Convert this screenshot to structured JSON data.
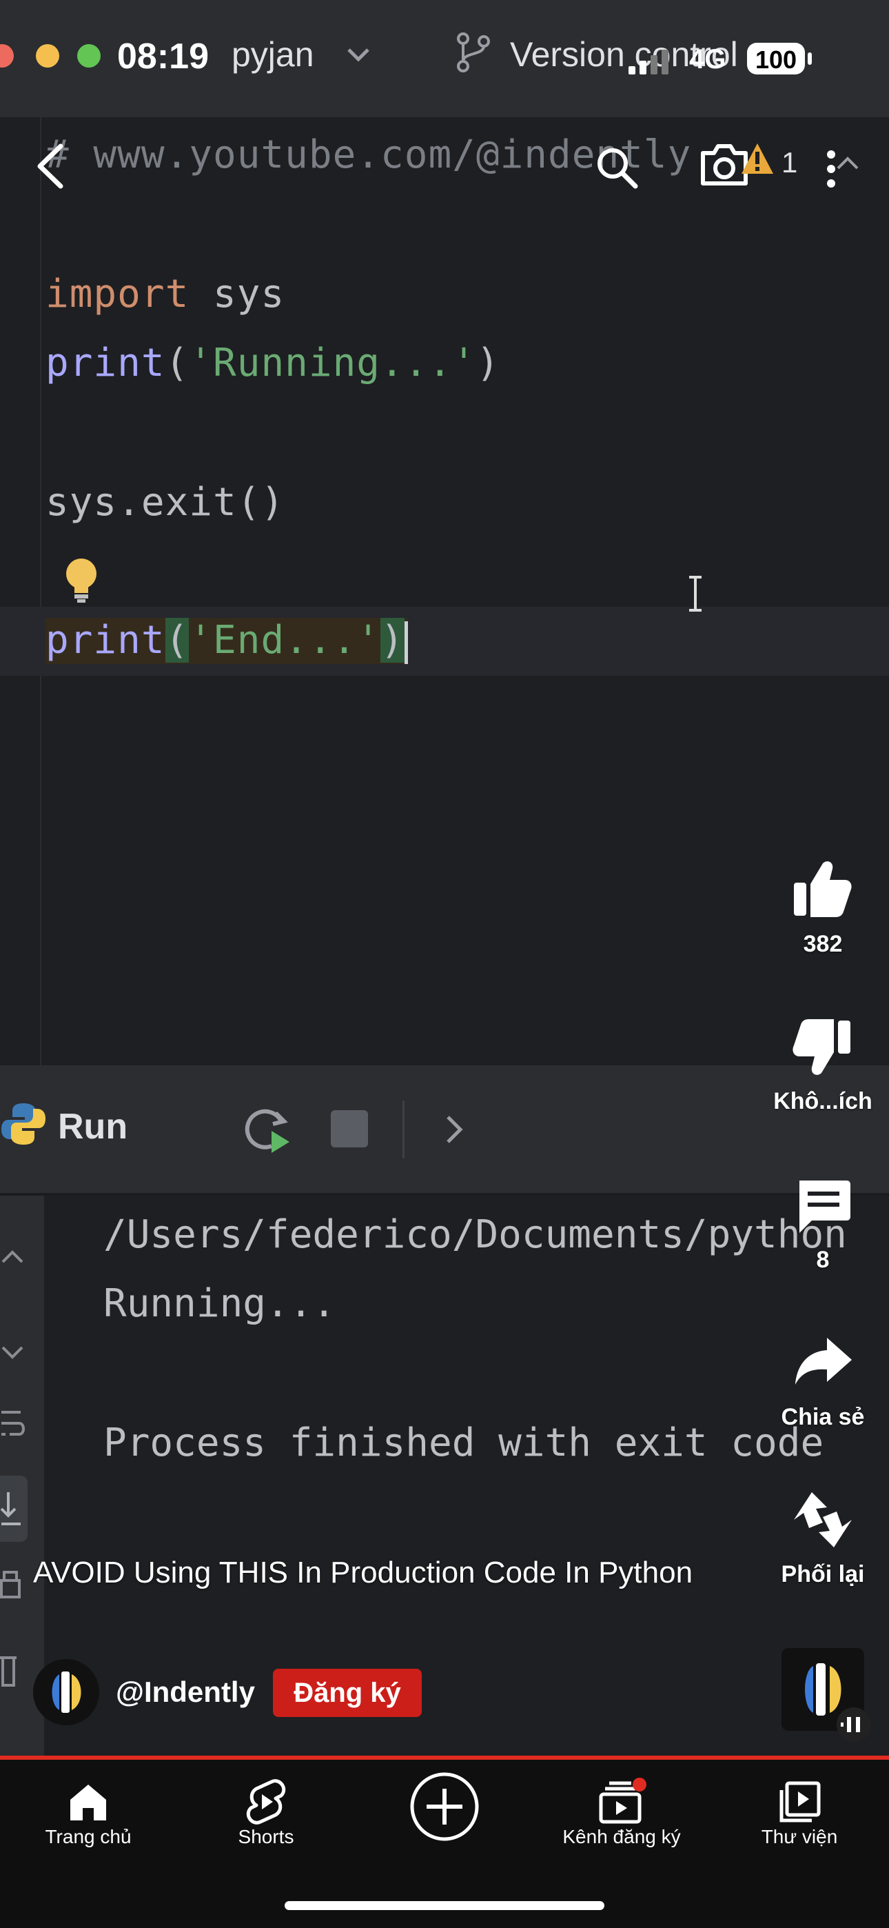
{
  "status_bar": {
    "time": "08:19",
    "network": "4G",
    "battery": "100"
  },
  "ide": {
    "project_name": "pyjan",
    "vcs_label": "Version control",
    "comment_line": "# www.youtube.com/@indently",
    "warning_count": "1",
    "code": {
      "line1_kw": "import",
      "line1_rest": " sys",
      "line2_fn": "print",
      "line2_open": "(",
      "line2_str": "'Running...'",
      "line2_close": ")",
      "line3": "sys.exit()",
      "line4_fn": "print",
      "line4_open": "(",
      "line4_str": "'End...'",
      "line4_close": ")"
    },
    "run_tab_label": "Run",
    "console": {
      "line1": "/Users/federico/Documents/python",
      "line2": "Running...",
      "line3": "Process finished with exit code"
    }
  },
  "video": {
    "title": "AVOID Using THIS In Production Code In Python",
    "channel": "@Indently",
    "subscribe_label": "Đăng ký",
    "likes": "382",
    "dislike_label": "Khô...ích",
    "comments": "8",
    "share_label": "Chia sẻ",
    "remix_label": "Phối lại"
  },
  "nav": {
    "items": [
      {
        "label": "Trang chủ",
        "icon": "home-icon"
      },
      {
        "label": "Shorts",
        "icon": "shorts-icon"
      },
      {
        "label": "",
        "icon": "create-icon"
      },
      {
        "label": "Kênh đăng ký",
        "icon": "subscriptions-icon"
      },
      {
        "label": "Thư viện",
        "icon": "library-icon"
      }
    ]
  },
  "colors": {
    "accent_red": "#e02b20",
    "keyword": "#cf8e6d",
    "function": "#a9a8ff",
    "string": "#6aab73"
  }
}
